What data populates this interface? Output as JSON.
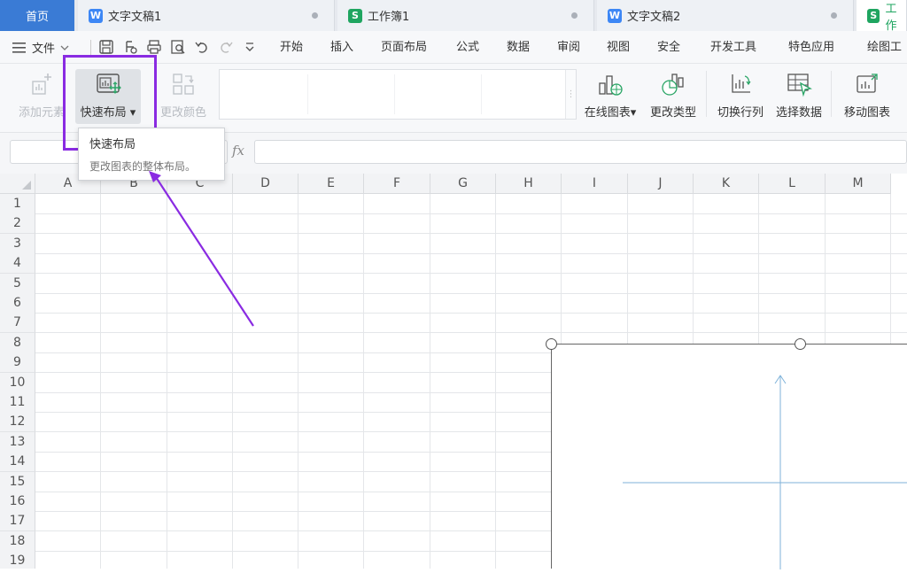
{
  "tabs": {
    "home": "首页",
    "items": [
      {
        "label": "文字文稿1",
        "type": "W"
      },
      {
        "label": "工作簿1",
        "type": "S"
      },
      {
        "label": "文字文稿2",
        "type": "W"
      },
      {
        "label": "工作",
        "type": "S"
      }
    ]
  },
  "menu": {
    "file": "文件",
    "items": [
      "开始",
      "插入",
      "页面布局",
      "公式",
      "数据",
      "审阅",
      "视图",
      "安全",
      "开发工具",
      "特色应用",
      "绘图工"
    ]
  },
  "ribbon": {
    "add_element": "添加元素",
    "quick_layout": "快速布局",
    "change_color": "更改颜色",
    "online_chart": "在线图表",
    "change_type": "更改类型",
    "switch_row_col": "切换行列",
    "select_data": "选择数据",
    "move_chart": "移动图表"
  },
  "tooltip": {
    "title": "快速布局",
    "desc": "更改图表的整体布局。"
  },
  "formula": {
    "fx": "fx"
  },
  "grid": {
    "columns": [
      "A",
      "B",
      "C",
      "D",
      "E",
      "F",
      "G",
      "H",
      "I",
      "J",
      "K",
      "L",
      "M"
    ],
    "rows": [
      "1",
      "2",
      "3",
      "4",
      "5",
      "6",
      "7",
      "8",
      "9",
      "10",
      "11",
      "12",
      "13",
      "14",
      "15",
      "16",
      "17",
      "18",
      "19"
    ]
  },
  "colors": {
    "home_tab": "#3a7bd5",
    "highlight": "#8a2be2",
    "arrow": "#8a2be2",
    "chart_axis": "#7fb2d9"
  }
}
